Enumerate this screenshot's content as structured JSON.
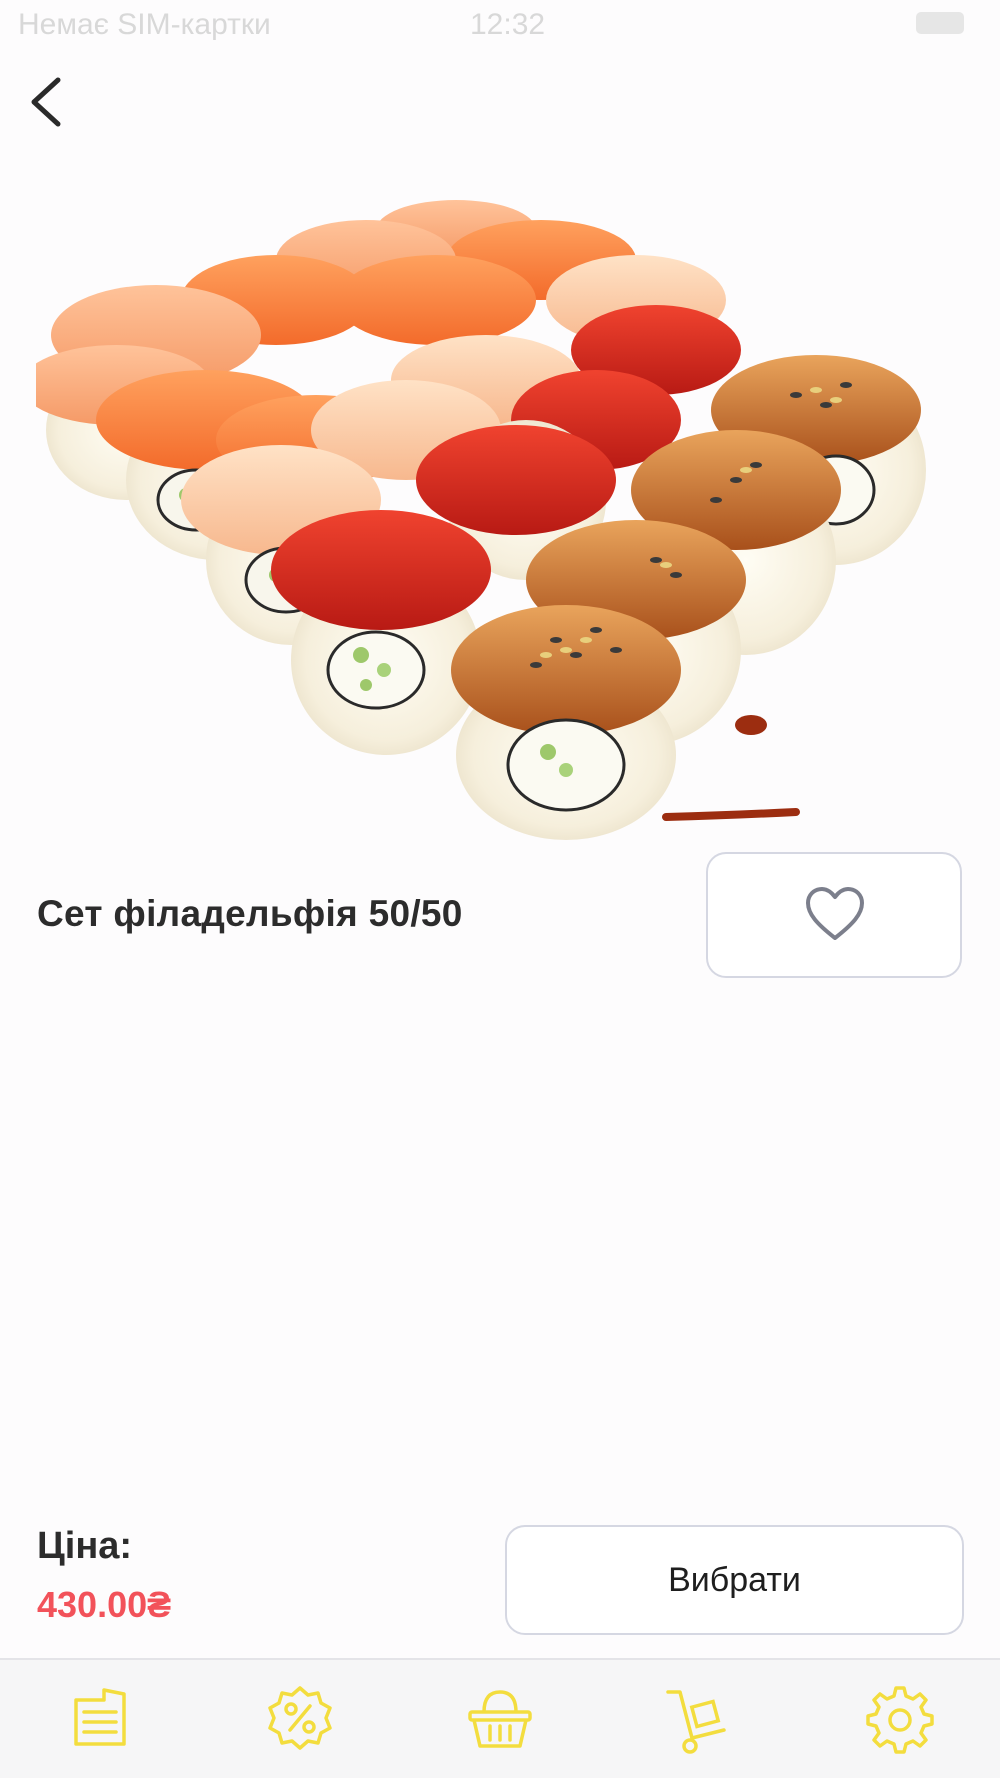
{
  "status_bar": {
    "carrier": "Немає SIM-картки",
    "time": "12:32"
  },
  "product": {
    "title": "Сет філадельфія 50/50",
    "image_icon": "sushi-set-photo"
  },
  "price": {
    "label": "Ціна:",
    "value": "430.00₴"
  },
  "actions": {
    "choose_label": "Вибрати"
  },
  "bottom_nav": {
    "items": [
      "menu-icon",
      "discount-icon",
      "basket-icon",
      "delivery-cart-icon",
      "settings-icon"
    ]
  },
  "colors": {
    "accent_yellow": "#f3dd3e",
    "price_red": "#f2525a",
    "border": "#d5d7e2"
  }
}
